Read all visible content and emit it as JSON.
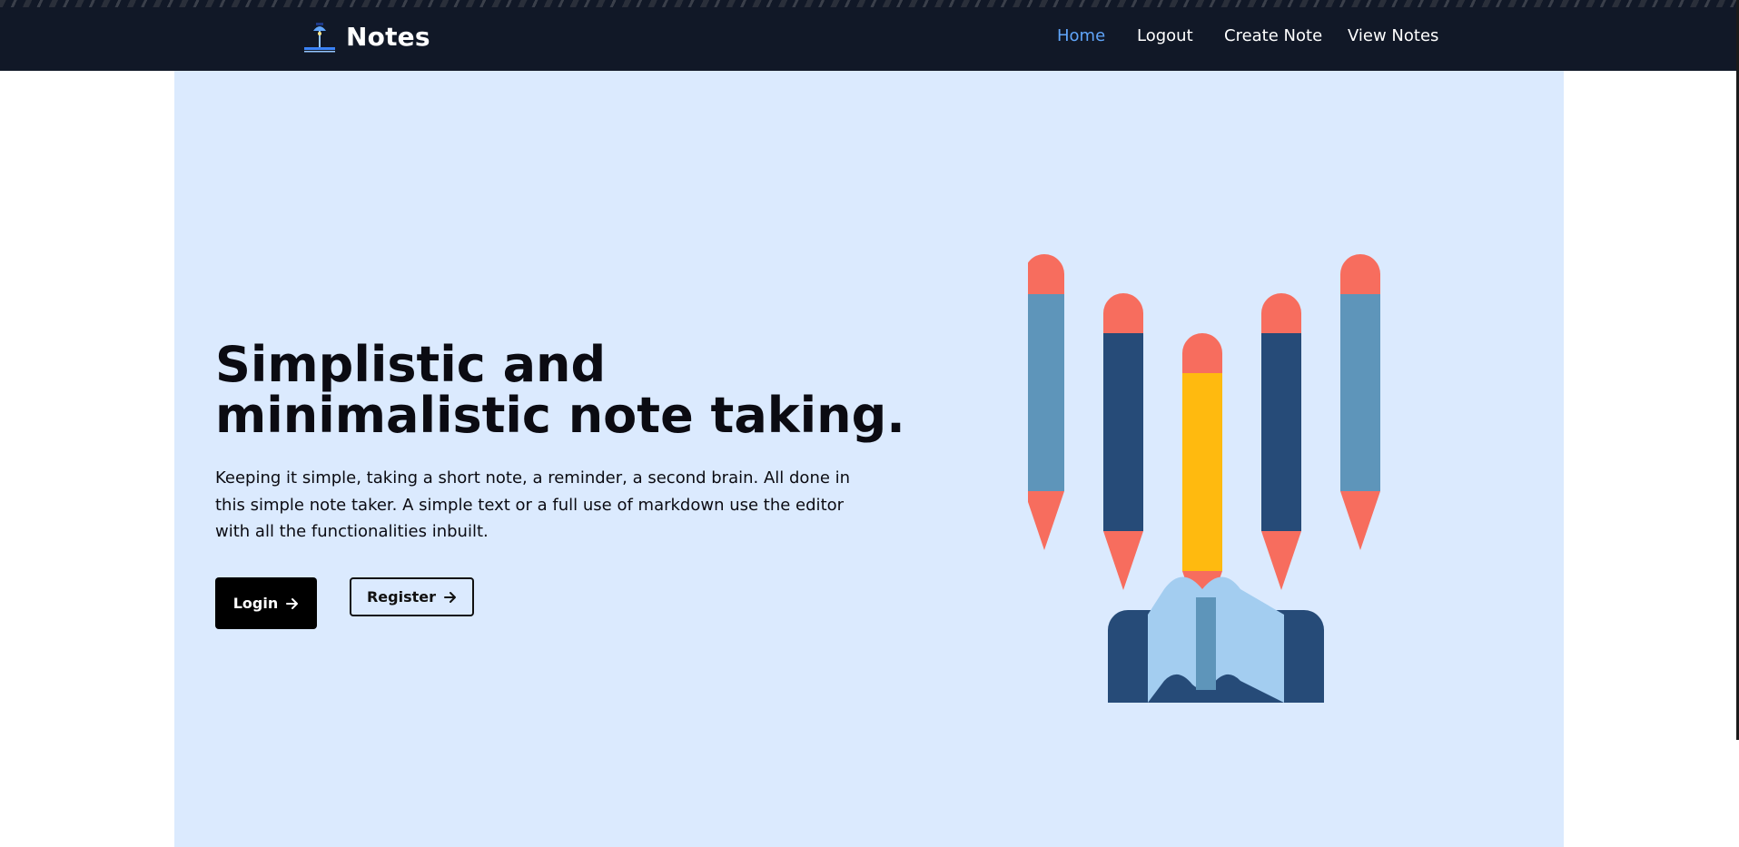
{
  "navbar": {
    "brand": "Notes",
    "brand_icon": "desk-lamp-icon",
    "links": [
      {
        "label": "Home",
        "active": true
      },
      {
        "label": "Logout",
        "active": false
      },
      {
        "label": "Create Note",
        "active": false
      },
      {
        "label": "View Notes",
        "active": false
      }
    ]
  },
  "hero": {
    "title": "Simplistic and minimalistic note taking.",
    "description": "Keeping it simple, taking a short note, a reminder, a second brain. All done in this simple note taker. A simple text or a full use of markdown use the editor with all the functionalities inbuilt.",
    "login_label": "Login",
    "register_label": "Register",
    "button_icon": "arrow-right-icon",
    "illustration": "pencils-and-book-illustration"
  },
  "colors": {
    "navbar_bg": "#111827",
    "hero_bg": "#dbeafe",
    "active_link": "#60a5fa",
    "pencil_light": "#5e95ba",
    "pencil_dark": "#264b78",
    "pencil_yellow": "#ffba0f",
    "pencil_tip": "#f76d5e",
    "book_page": "#a3cdf0"
  }
}
